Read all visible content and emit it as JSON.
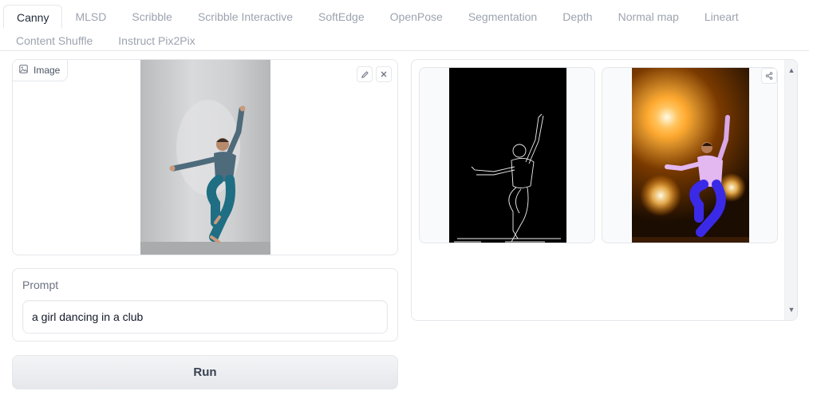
{
  "tabs": {
    "row1": [
      "Canny",
      "MLSD",
      "Scribble",
      "Scribble Interactive",
      "SoftEdge",
      "OpenPose",
      "Segmentation",
      "Depth",
      "Normal map",
      "Lineart"
    ],
    "row2": [
      "Content Shuffle",
      "Instruct Pix2Pix"
    ],
    "active": "Canny"
  },
  "input_image": {
    "label": "Image",
    "icon": "image-icon",
    "tools": [
      "edit-icon",
      "close-icon"
    ]
  },
  "prompt": {
    "label": "Prompt",
    "value": "a girl dancing in a club"
  },
  "run": {
    "label": "Run"
  },
  "gallery": {
    "items": [
      "canny-edge-result",
      "generated-result"
    ],
    "share_icon": "share-icon",
    "scroll_icons": [
      "scroll-up-arrow",
      "scroll-down-arrow"
    ]
  },
  "colors": {
    "border": "#e5e7eb",
    "button_bg": "#e5e7eb",
    "active_tab_text": "#1f2937",
    "inactive_tab_text": "#9ca3af"
  }
}
